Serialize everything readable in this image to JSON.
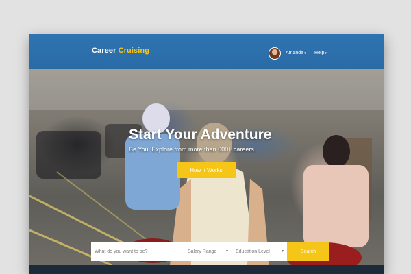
{
  "header": {
    "logo_primary": "Career",
    "logo_accent": "Cruising",
    "user_name": "Amanda",
    "help_label": "Help",
    "caret_icon": "▾",
    "colors": {
      "bar": "#2e74b2",
      "accent": "#f5c518"
    }
  },
  "hero": {
    "title": "Start Your Adventure",
    "subtitle": "Be You. Explore from more than 600+ careers.",
    "cta_label": "How It Works"
  },
  "search": {
    "query_placeholder": "What do you want to be?",
    "salary_label": "Salary Range",
    "education_label": "Education Level",
    "button_label": "Search"
  }
}
